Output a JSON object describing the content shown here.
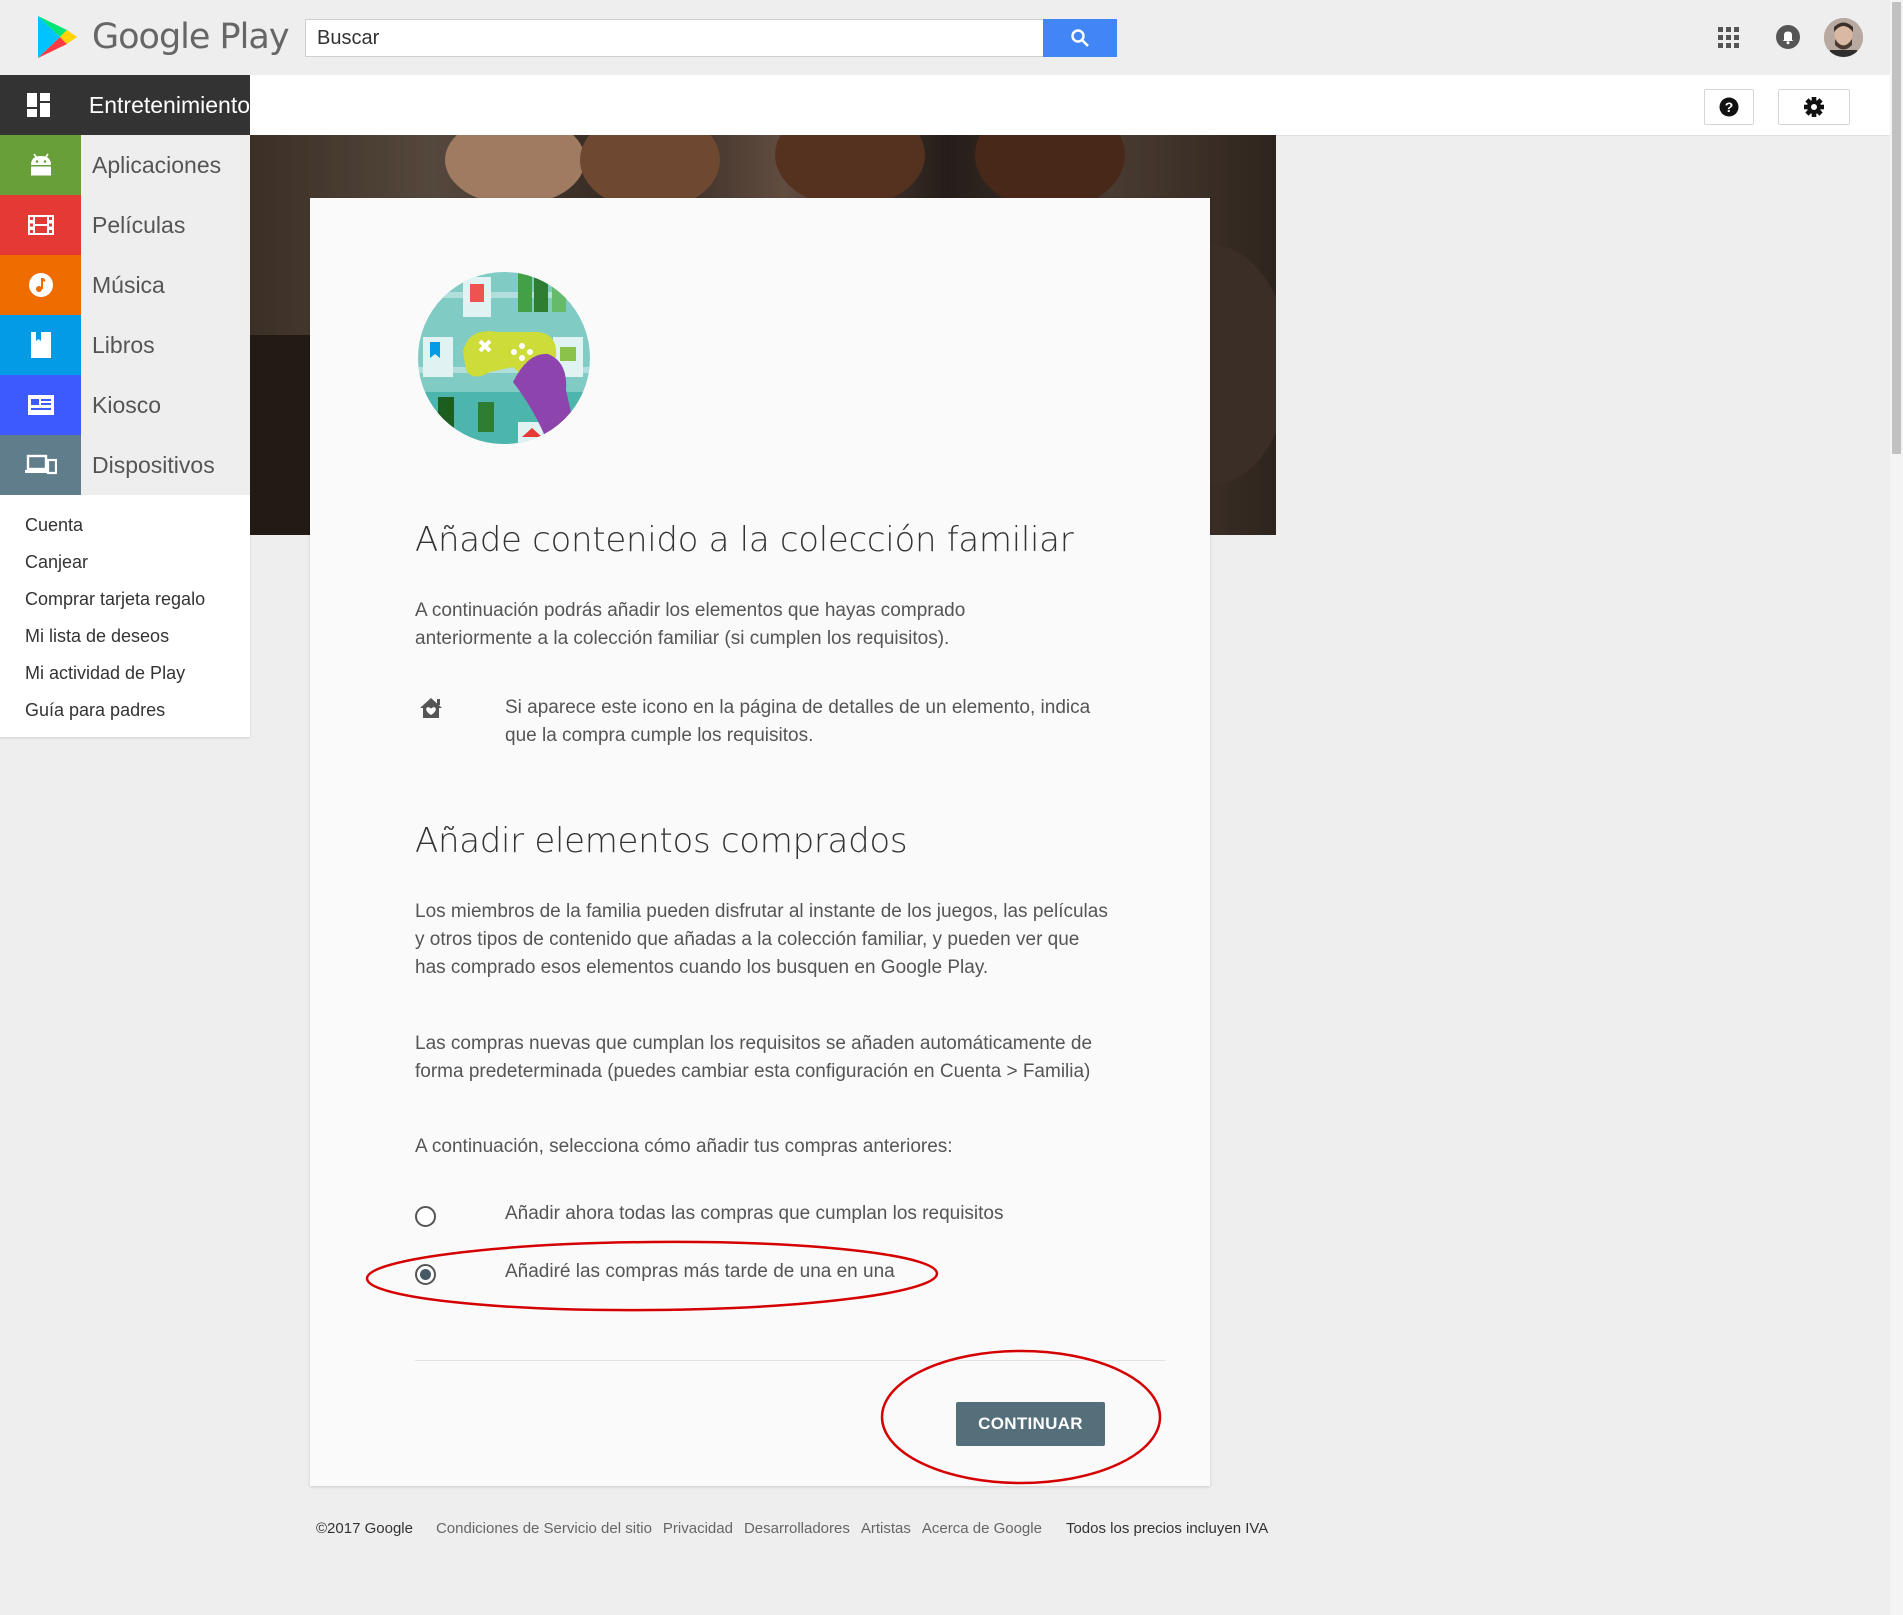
{
  "header": {
    "brand": "Google Play",
    "search_placeholder": "Buscar"
  },
  "colors": {
    "accent_blue": "#4285f4",
    "nav_active": "#333333",
    "apps": "#689f38",
    "movies": "#e53935",
    "music": "#ef6c00",
    "books": "#039be5",
    "newsstand": "#3d5afe",
    "devices": "#607d8b",
    "button": "#546e7a",
    "annotation_red": "#d50000"
  },
  "nav": {
    "items": [
      {
        "label": "Entretenimiento",
        "icon": "grid-icon",
        "active": true
      },
      {
        "label": "Aplicaciones",
        "icon": "android-icon"
      },
      {
        "label": "Películas",
        "icon": "film-icon"
      },
      {
        "label": "Música",
        "icon": "music-icon"
      },
      {
        "label": "Libros",
        "icon": "book-icon"
      },
      {
        "label": "Kiosco",
        "icon": "newsstand-icon"
      },
      {
        "label": "Dispositivos",
        "icon": "devices-icon"
      }
    ],
    "links": [
      "Cuenta",
      "Canjear",
      "Comprar tarjeta regalo",
      "Mi lista de deseos",
      "Mi actividad de Play",
      "Guía para padres"
    ]
  },
  "content": {
    "title": "Añade contenido a la colección familiar",
    "intro": "A continuación podrás añadir los elementos que hayas comprado anteriormente a la colección familiar (si cumplen los requisitos).",
    "icon_note": "Si aparece este icono en la página de detalles de un elemento, indica que la compra cumple los requisitos.",
    "section_title": "Añadir elementos comprados",
    "para1": "Los miembros de la familia pueden disfrutar al instante de los juegos, las películas y otros tipos de contenido que añadas a la colección familiar, y pueden ver que has comprado esos elementos cuando los busquen en Google Play.",
    "para2": "Las compras nuevas que cumplan los requisitos se añaden automáticamente de forma predeterminada (puedes cambiar esta configuración en Cuenta > Familia)",
    "para3": "A continuación, selecciona cómo añadir tus compras anteriores:",
    "options": [
      {
        "label": "Añadir ahora todas las compras que cumplan los requisitos",
        "selected": false
      },
      {
        "label": "Añadiré las compras más tarde de una en una",
        "selected": true
      }
    ],
    "continue_label": "CONTINUAR"
  },
  "footer": {
    "copyright": "©2017 Google",
    "links": [
      "Condiciones de Servicio del sitio",
      "Privacidad",
      "Desarrolladores",
      "Artistas",
      "Acerca de Google"
    ],
    "vat_note": "Todos los precios incluyen IVA"
  }
}
